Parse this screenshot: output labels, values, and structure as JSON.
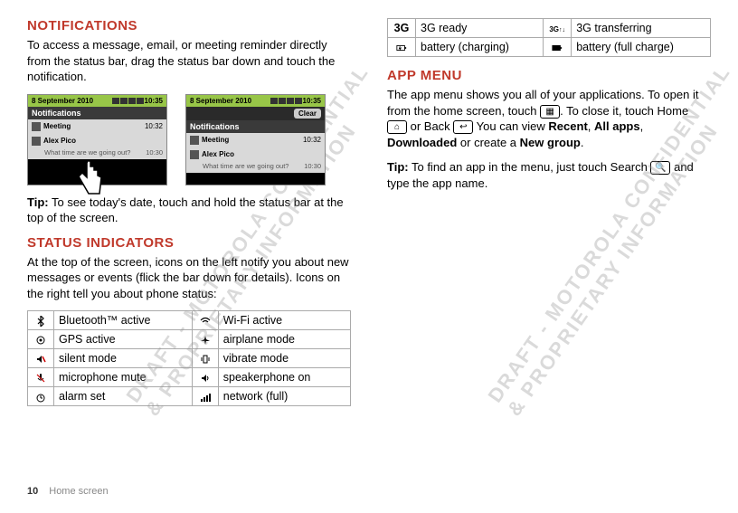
{
  "left": {
    "notifications_heading": "NOTIFICATIONS",
    "notifications_body": "To access a message, email, or meeting reminder directly from the status bar, drag the status bar down and touch the notification.",
    "phone": {
      "date": "8 September 2010",
      "time": "10:35",
      "notif_label": "Notifications",
      "clear": "Clear",
      "item1": "Meeting",
      "item1_time": "10:32",
      "item2": "Alex Pico",
      "item2_sub": "What time are we going out?",
      "item2_time": "10:30"
    },
    "tip1_label": "Tip:",
    "tip1_body": " To see today's date, touch and hold the status bar at the top of the screen.",
    "status_heading": "STATUS INDICATORS",
    "status_body": "At the top of the screen, icons on the left notify you about new messages or events (flick the bar down for details). Icons on the right tell you about phone status:",
    "table": {
      "r1c1": "Bluetooth™ active",
      "r1c2": "Wi-Fi active",
      "r2c1": "GPS active",
      "r2c2": "airplane mode",
      "r3c1": "silent mode",
      "r3c2": "vibrate mode",
      "r4c1": "microphone mute",
      "r4c2": "speakerphone on",
      "r5c1": "alarm set",
      "r5c2": "network (full)"
    }
  },
  "right": {
    "table": {
      "r1i1": "3G",
      "r1c1": "3G ready",
      "r1i2": "3G",
      "r1c2": "3G transferring",
      "r2c1": "battery (charging)",
      "r2c2": "battery (full charge)"
    },
    "app_heading": "APP MENU",
    "app_body1a": "The app menu shows you all of your applications. To open it from the home screen, touch ",
    "app_body1b": ". To close it, touch Home ",
    "app_body1c": " or Back ",
    "app_body1d": " You can view ",
    "recent": "Recent",
    "allapps": "All apps",
    "downloaded": "Downloaded",
    "or_create": " or create a ",
    "newgroup": "New group",
    "period": ".",
    "comma": ", ",
    "tip2_label": "Tip:",
    "tip2_body1": " To find an app in the menu, just touch Search ",
    "tip2_body2": " and type the app name."
  },
  "watermark1": "DRAFT - MOTOROLA CONFIDENTIAL\n& PROPRIETARY INFORMATION",
  "watermark2": "DRAFT - MOTOROLA CONFIDENTIAL\n& PROPRIETARY INFORMATION",
  "footer_page": "10",
  "footer_text": "Home screen"
}
